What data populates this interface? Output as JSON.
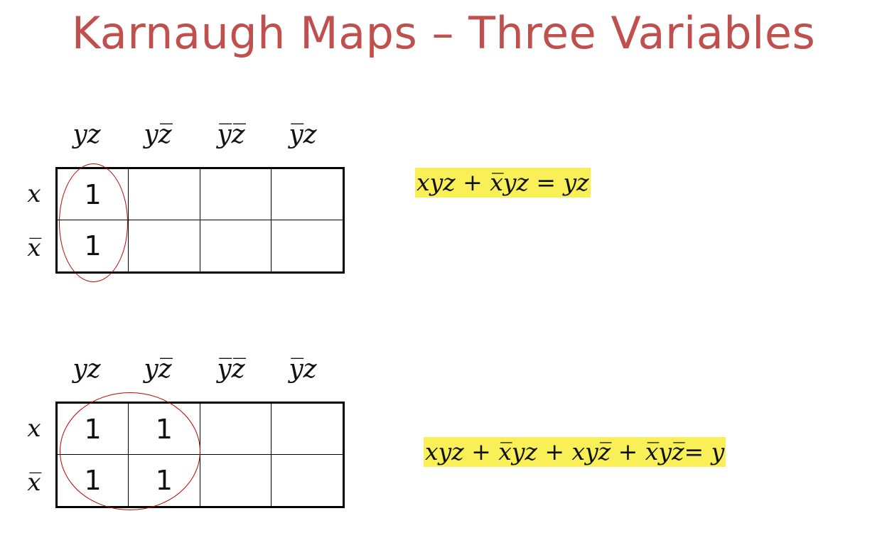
{
  "title": "Karnaugh Maps – Three Variables",
  "kmaps": [
    {
      "col_headers": [
        "yz",
        "y̅z̅",
        "y̅z̅",
        "y̅z"
      ],
      "col_headers_display": [
        "yz",
        "yz̅",
        "y̅z̅",
        "y̅z"
      ],
      "row_headers": [
        "x",
        "x̅"
      ],
      "cells": [
        [
          "1",
          "",
          "",
          ""
        ],
        [
          "1",
          "",
          "",
          ""
        ]
      ],
      "expression": "xyz + x̅yz = yz"
    },
    {
      "col_headers": [
        "yz",
        "yz̅",
        "y̅z̅",
        "y̅z"
      ],
      "col_headers_display": [
        "yz",
        "yz̅",
        "y̅z̅",
        "y̅z"
      ],
      "row_headers": [
        "x",
        "x̅"
      ],
      "cells": [
        [
          "1",
          "1",
          "",
          ""
        ],
        [
          "1",
          "1",
          "",
          ""
        ]
      ],
      "expression": "xyz + x̅yz  + xyz̅ + x̅yz̅= y"
    }
  ]
}
